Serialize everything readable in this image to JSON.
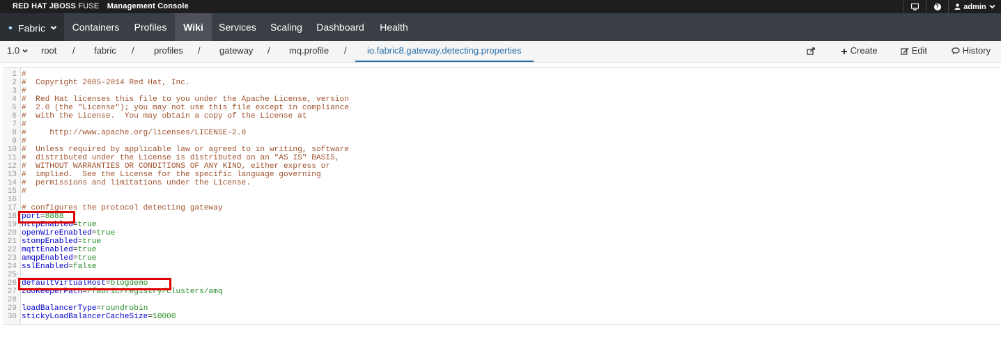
{
  "header": {
    "brand": "RED HAT JBOSS",
    "brand_product": "FUSE",
    "console_title": "Management Console",
    "user": "admin",
    "monitor_icon": "monitor-icon",
    "help_label": "?",
    "user_icon": "user-icon"
  },
  "nav": {
    "perspective": "Fabric",
    "items": [
      "Containers",
      "Profiles",
      "Wiki",
      "Services",
      "Scaling",
      "Dashboard",
      "Health"
    ],
    "active": "Wiki"
  },
  "breadcrumb": {
    "version": "1.0",
    "items": [
      "root",
      "fabric",
      "profiles",
      "gateway",
      "mq.profile"
    ],
    "current": "io.fabric8.gateway.detecting.properties",
    "separator": "/"
  },
  "actions": {
    "share_icon": "share-icon",
    "create": "Create",
    "edit": "Edit",
    "history": "History"
  },
  "editor": {
    "lines": [
      {
        "n": "1",
        "type": "comment",
        "text": "#"
      },
      {
        "n": "2",
        "type": "comment",
        "text": "#  Copyright 2005-2014 Red Hat, Inc."
      },
      {
        "n": "3",
        "type": "comment",
        "text": "#"
      },
      {
        "n": "4",
        "type": "comment",
        "text": "#  Red Hat licenses this file to you under the Apache License, version"
      },
      {
        "n": "5",
        "type": "comment",
        "text": "#  2.0 (the \"License\"); you may not use this file except in compliance"
      },
      {
        "n": "6",
        "type": "comment",
        "text": "#  with the License.  You may obtain a copy of the License at"
      },
      {
        "n": "7",
        "type": "comment",
        "text": "#"
      },
      {
        "n": "8",
        "type": "comment",
        "text": "#     http://www.apache.org/licenses/LICENSE-2.0"
      },
      {
        "n": "9",
        "type": "comment",
        "text": "#"
      },
      {
        "n": "10",
        "type": "comment",
        "text": "#  Unless required by applicable law or agreed to in writing, software"
      },
      {
        "n": "11",
        "type": "comment",
        "text": "#  distributed under the License is distributed on an \"AS IS\" BASIS,"
      },
      {
        "n": "12",
        "type": "comment",
        "text": "#  WITHOUT WARRANTIES OR CONDITIONS OF ANY KIND, either express or"
      },
      {
        "n": "13",
        "type": "comment",
        "text": "#  implied.  See the License for the specific language governing"
      },
      {
        "n": "14",
        "type": "comment",
        "text": "#  permissions and limitations under the License."
      },
      {
        "n": "15",
        "type": "comment",
        "text": "#"
      },
      {
        "n": "16",
        "type": "blank",
        "text": ""
      },
      {
        "n": "17",
        "type": "comment",
        "text": "# configures the protocol detecting gateway"
      },
      {
        "n": "18",
        "type": "prop",
        "key": "port",
        "value": "8888"
      },
      {
        "n": "19",
        "type": "prop",
        "key": "httpEnabled",
        "value": "true"
      },
      {
        "n": "20",
        "type": "prop",
        "key": "openWireEnabled",
        "value": "true"
      },
      {
        "n": "21",
        "type": "prop",
        "key": "stompEnabled",
        "value": "true"
      },
      {
        "n": "22",
        "type": "prop",
        "key": "mqttEnabled",
        "value": "true"
      },
      {
        "n": "23",
        "type": "prop",
        "key": "amqpEnabled",
        "value": "true"
      },
      {
        "n": "24",
        "type": "prop",
        "key": "sslEnabled",
        "value": "false"
      },
      {
        "n": "25",
        "type": "blank",
        "text": ""
      },
      {
        "n": "26",
        "type": "prop",
        "key": "defaultVirtualHost",
        "value": "blogdemo"
      },
      {
        "n": "27",
        "type": "prop",
        "key": "zooKeeperPath",
        "value": "/fabric/registry/clusters/amq"
      },
      {
        "n": "28",
        "type": "blank",
        "text": ""
      },
      {
        "n": "29",
        "type": "prop",
        "key": "loadBalancerType",
        "value": "roundrobin"
      },
      {
        "n": "30",
        "type": "prop",
        "key": "stickyLoadBalancerCacheSize",
        "value": "10000"
      }
    ],
    "highlight_color": "#e00000"
  }
}
